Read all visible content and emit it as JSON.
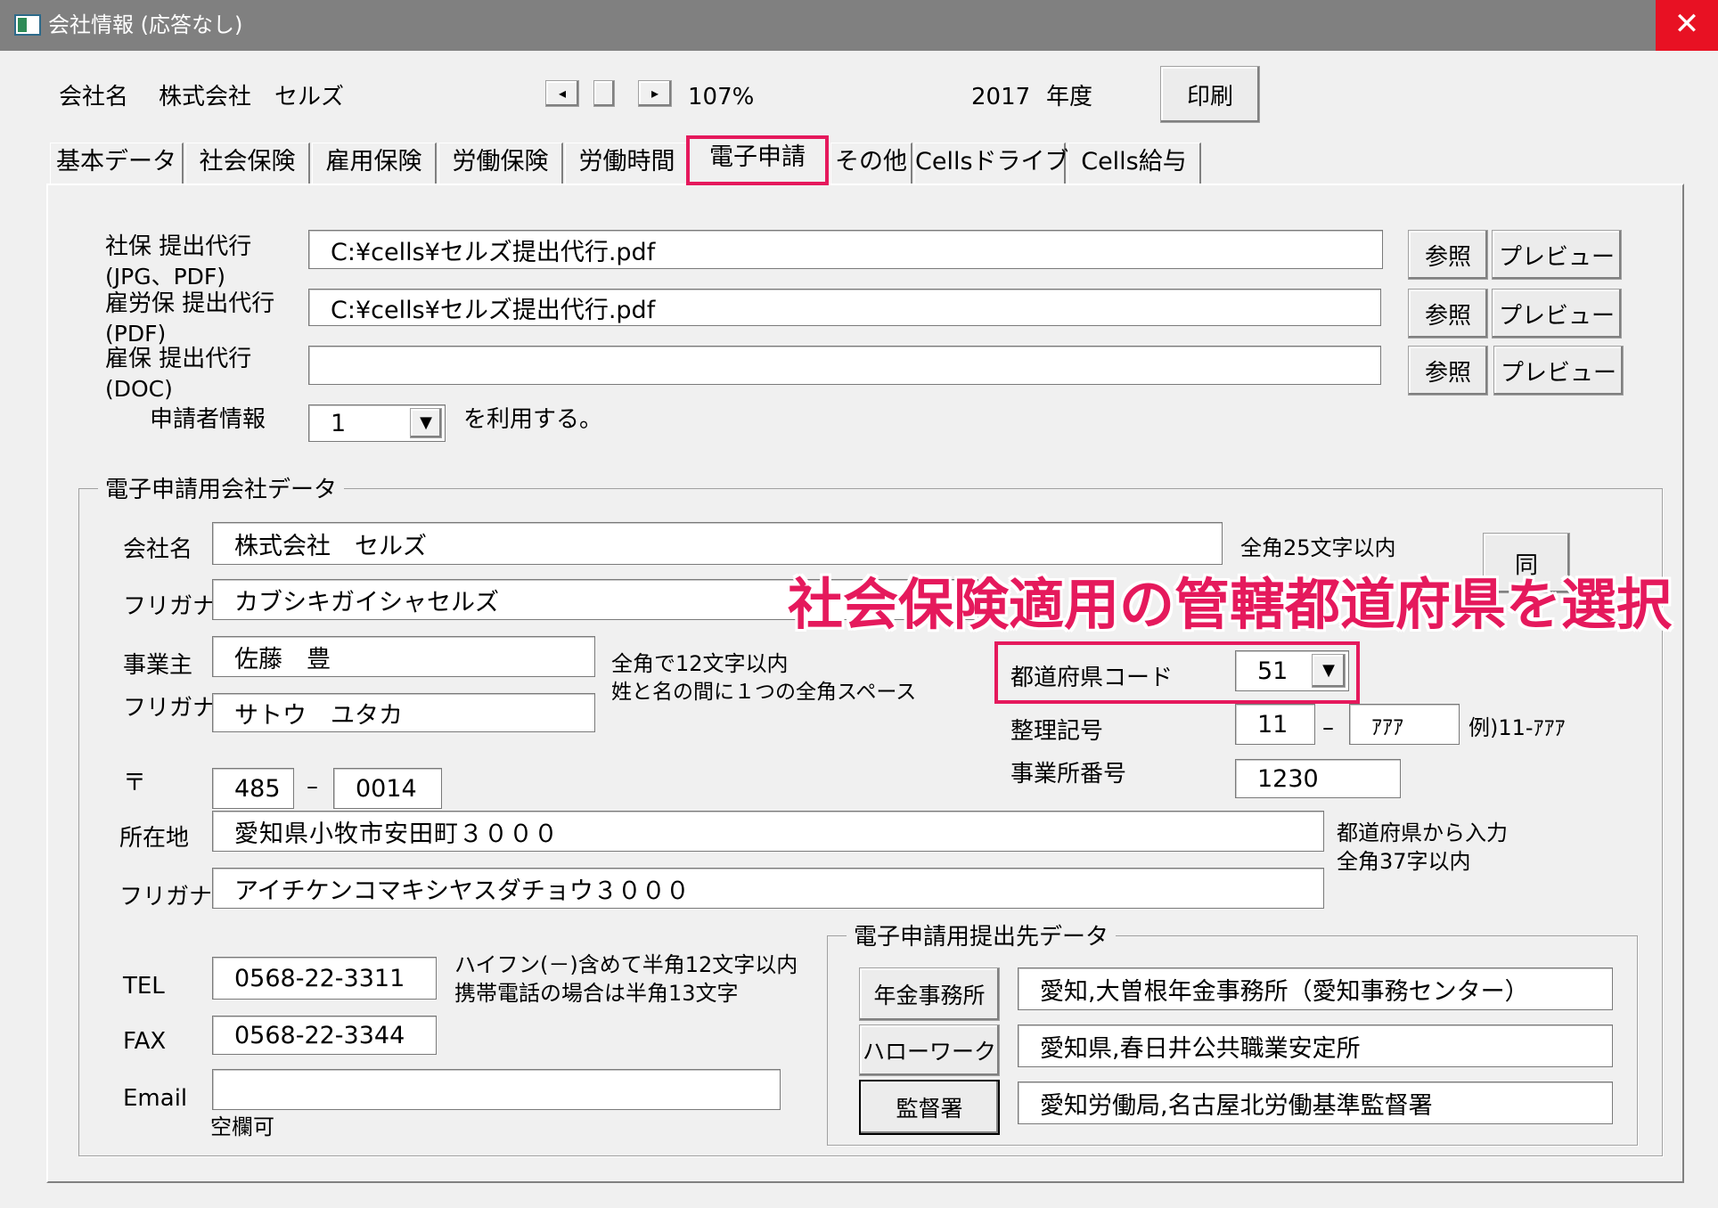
{
  "window": {
    "title": "会社情報 (応答なし)",
    "close_glyph": "✕"
  },
  "header": {
    "company_label": "会社名",
    "company_name": "株式会社　セルズ",
    "zoom": "107%",
    "year": "2017",
    "year_suffix": "年度",
    "print_button": "印刷",
    "left_arrow": "◂",
    "right_arrow": "▸"
  },
  "tabs": [
    {
      "label": "基本データ"
    },
    {
      "label": "社会保険"
    },
    {
      "label": "雇用保険"
    },
    {
      "label": "労働保険"
    },
    {
      "label": "労働時間"
    },
    {
      "label": "電子申請"
    },
    {
      "label": "その他"
    },
    {
      "label": "Cellsドライブ"
    },
    {
      "label": "Cells給与"
    }
  ],
  "filing": {
    "rows": [
      {
        "label1": "社保 提出代行",
        "label2": "(JPG、PDF)",
        "value": "C:¥cells¥セルズ提出代行.pdf",
        "browse": "参照",
        "preview": "プレビュー"
      },
      {
        "label1": "雇労保 提出代行",
        "label2": "(PDF)",
        "value": "C:¥cells¥セルズ提出代行.pdf",
        "browse": "参照",
        "preview": "プレビュー"
      },
      {
        "label1": "雇保 提出代行",
        "label2": "(DOC)",
        "value": "",
        "browse": "参照",
        "preview": "プレビュー"
      }
    ],
    "applicant_label": "申請者情報",
    "applicant_value": "1",
    "applicant_suffix": "を利用する。"
  },
  "company_data": {
    "group_title": "電子申請用会社データ",
    "name_label": "会社名",
    "name_value": "株式会社　セルズ",
    "name_note": "全角25文字以内",
    "same_button": "同",
    "furigana_label": "フリガナ",
    "furigana_value": "カブシキガイシャセルズ",
    "owner_label": "事業主",
    "owner_value": "佐藤　豊",
    "owner_note1": "全角で12文字以内",
    "owner_note2": "姓と名の間に１つの全角スペース",
    "owner_furigana_label": "フリガナ",
    "owner_furigana_value": "サトウ　ユタカ",
    "pref_code_label": "都道府県コード",
    "pref_code_value": "51",
    "seiri_label": "整理記号",
    "seiri_value1": "11",
    "seiri_dash": "–",
    "seiri_value2": "ｱｱｱ",
    "seiri_example": "例)11-ｱｱｱ",
    "office_no_label": "事業所番号",
    "office_no_value": "1230",
    "zip_label": "〒",
    "zip1": "485",
    "zip_dash": "–",
    "zip2": "0014",
    "address_label": "所在地",
    "address_value": "愛知県小牧市安田町３０００",
    "address_note1": "都道府県から入力",
    "address_note2": "全角37字以内",
    "address_furigana_label": "フリガナ",
    "address_furigana_value": "アイチケンコマキシヤスダチョウ３０００",
    "tel_label": "TEL",
    "tel_value": "0568-22-3311",
    "tel_note1": "ハイフン(－)含めて半角12文字以内",
    "tel_note2": "携帯電話の場合は半角13文字",
    "fax_label": "FAX",
    "fax_value": "0568-22-3344",
    "email_label": "Email",
    "email_value": "",
    "email_note": "空欄可"
  },
  "submission": {
    "group_title": "電子申請用提出先データ",
    "rows": [
      {
        "button": "年金事務所",
        "value": "愛知,大曽根年金事務所（愛知事務センター）"
      },
      {
        "button": "ハローワーク",
        "value": "愛知県,春日井公共職業安定所"
      },
      {
        "button": "監督署",
        "value": "愛知労働局,名古屋北労働基準監督署"
      }
    ]
  },
  "annotation": {
    "text": "社会保険適用の管轄都道府県を選択",
    "color": "#e5195c"
  },
  "icons": {
    "dropdown": "▼"
  }
}
